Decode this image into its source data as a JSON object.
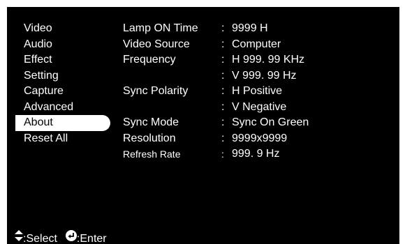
{
  "menu": {
    "items": [
      {
        "label": "Video"
      },
      {
        "label": "Audio"
      },
      {
        "label": "Effect"
      },
      {
        "label": "Setting"
      },
      {
        "label": "Capture"
      },
      {
        "label": "Advanced"
      },
      {
        "label": "About"
      },
      {
        "label": "Reset All"
      }
    ],
    "selected_index": 6
  },
  "info": {
    "colon": ":",
    "rows": [
      {
        "label": "Lamp ON Time",
        "value": "9999 H"
      },
      {
        "label": "Video Source",
        "value": "Computer"
      },
      {
        "label": "Frequency",
        "value": "H 999. 99 KHz"
      },
      {
        "label": "",
        "value": "V 999. 99 Hz"
      },
      {
        "label": "Sync Polarity",
        "value": "H Positive"
      },
      {
        "label": "",
        "value": "V Negative"
      },
      {
        "label": "Sync Mode",
        "value": "Sync On Green"
      },
      {
        "label": "Resolution",
        "value": "9999x9999"
      },
      {
        "label": "Refresh Rate",
        "value": "999. 9 Hz"
      }
    ]
  },
  "footer": {
    "select_label": ":Select",
    "enter_label": ":Enter",
    "select_icon": "up-down-arrows-icon",
    "enter_icon": "enter-return-icon"
  },
  "colors": {
    "background": "#000000",
    "text": "#ffffff",
    "highlight_bg": "#ffffff",
    "highlight_text": "#000000"
  }
}
